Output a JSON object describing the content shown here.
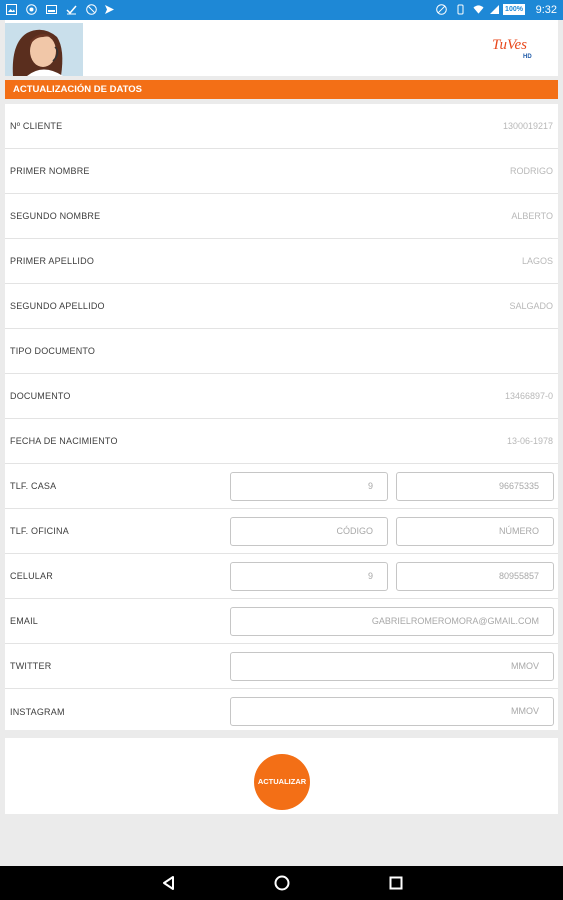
{
  "status_bar": {
    "time": "9:32",
    "battery": "100%",
    "left_icons": [
      "image-icon",
      "globe-icon",
      "photo-icon",
      "download-icon",
      "blocked-icon",
      "send-icon"
    ],
    "right_icons": [
      "dnd-icon",
      "vibrate-icon",
      "wifi-icon",
      "signal-icon",
      "battery-icon"
    ]
  },
  "header": {
    "logo_text": "TuVes",
    "logo_sub": "HD"
  },
  "banner": {
    "title": "ACTUALIZACIÓN DE DATOS"
  },
  "fields": [
    {
      "label": "Nº CLIENTE",
      "value": "1300019217"
    },
    {
      "label": "PRIMER NOMBRE",
      "value": "RODRIGO"
    },
    {
      "label": "SEGUNDO NOMBRE",
      "value": "ALBERTO"
    },
    {
      "label": "PRIMER APELLIDO",
      "value": "LAGOS"
    },
    {
      "label": "SEGUNDO APELLIDO",
      "value": "SALGADO"
    },
    {
      "label": "TIPO DOCUMENTO",
      "value": ""
    },
    {
      "label": "DOCUMENTO",
      "value": "13466897-0"
    },
    {
      "label": "FECHA DE NACIMIENTO",
      "value": "13-06-1978"
    }
  ],
  "phones": {
    "casa": {
      "label": "TLF.  CASA",
      "code": "9",
      "number": "96675335"
    },
    "oficina": {
      "label": "TLF. OFICINA",
      "code_placeholder": "CÓDIGO",
      "number_placeholder": "NÚMERO"
    },
    "celular": {
      "label": "CELULAR",
      "code": "9",
      "number": "80955857"
    }
  },
  "email": {
    "label": "EMAIL",
    "value": "GABRIELROMEROMORA@GMAIL.COM"
  },
  "twitter": {
    "label": "TWITTER",
    "value": "MMOV"
  },
  "instagram": {
    "label": "INSTAGRAM",
    "value": "MMOV"
  },
  "submit": {
    "label": "ACTUALIZAR"
  },
  "colors": {
    "accent": "#f36f16",
    "status_bar": "#1e88d6",
    "background": "#ebebeb"
  },
  "nav": {
    "back": "back-icon",
    "home": "home-icon",
    "recents": "recents-icon"
  }
}
